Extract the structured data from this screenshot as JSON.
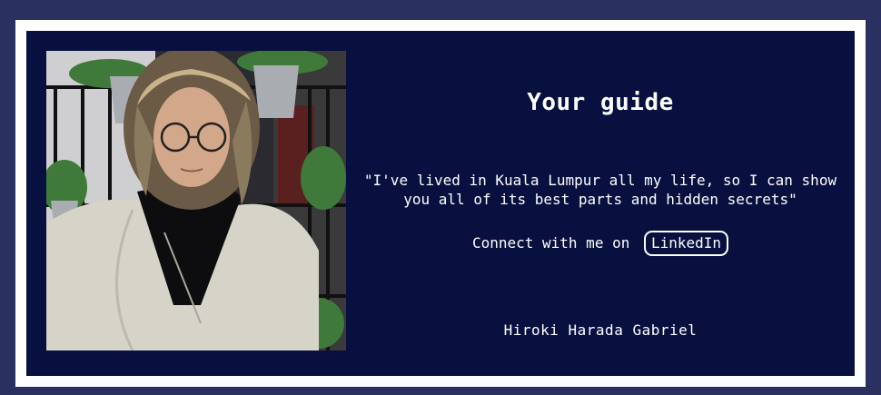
{
  "guide": {
    "title": "Your guide",
    "quote": "\"I've lived in Kuala Lumpur all my life, so I can show you all of its best parts and hidden secrets\"",
    "connect_text": "Connect with me on",
    "link_label": "LinkedIn",
    "name": "Hiroki Harada Gabriel"
  },
  "colors": {
    "page_background": "#2a3160",
    "frame": "#ffffff",
    "card_background": "#07103f",
    "text": "#ffffff"
  }
}
